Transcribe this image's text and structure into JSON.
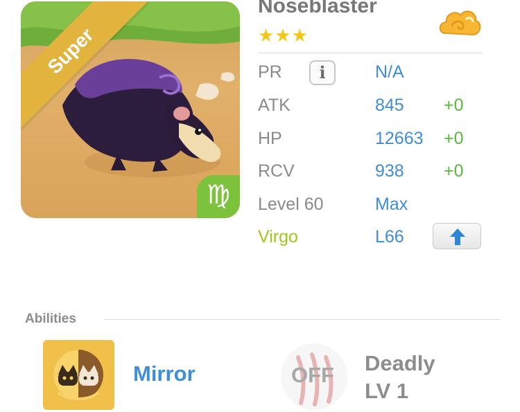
{
  "pet": {
    "rarity_label": "Super",
    "name": "Noseblaster",
    "stars": "★★★",
    "element_icon": "cloud-icon",
    "sign_glyph": "♍"
  },
  "stats": {
    "pr": {
      "label": "PR",
      "value": "N/A"
    },
    "atk": {
      "label": "ATK",
      "value": "845",
      "bonus": "+0"
    },
    "hp": {
      "label": "HP",
      "value": "12663",
      "bonus": "+0"
    },
    "rcv": {
      "label": "RCV",
      "value": "938",
      "bonus": "+0"
    },
    "level": {
      "label": "Level 60",
      "value": "Max"
    },
    "sign": {
      "label": "Virgo",
      "value": "L66"
    }
  },
  "abilities": {
    "title": "Abilities",
    "first": {
      "name": "Mirror"
    },
    "second": {
      "state": "OFF",
      "name": "Deadly",
      "level": "LV 1"
    }
  },
  "colors": {
    "accent_blue": "#3f8ed6",
    "bonus_green": "#59b83b",
    "sign_green": "#9cc91c",
    "star_gold": "#f3c61a"
  }
}
